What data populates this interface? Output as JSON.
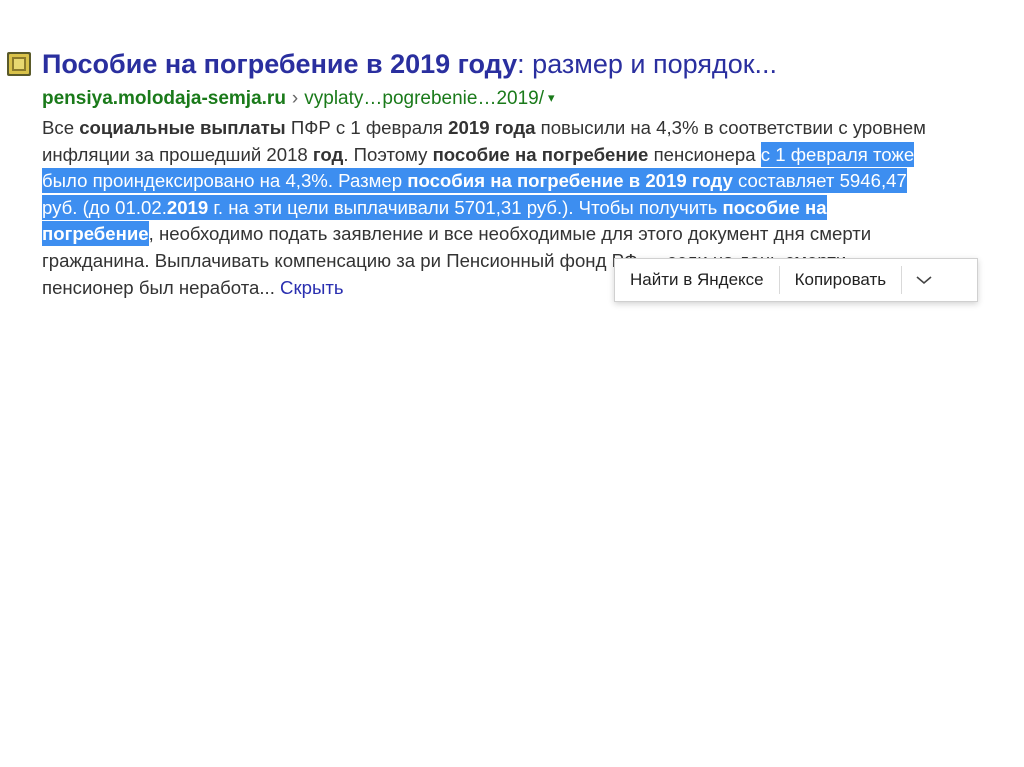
{
  "result": {
    "favicon_icon": "site-favicon-icon",
    "title_bold": "Пособие на погребение в 2019 году",
    "title_rest": ": размер и порядок...",
    "url_host": "pensiya.molodaja-semja.ru",
    "url_separator": "›",
    "url_path": "vyplaty…pogrebenie…2019/",
    "url_arrow": "▾",
    "snippet": {
      "s1": "Все ",
      "b1": "социальные выплаты",
      "s2": " ПФР с 1 февраля ",
      "b2": "2019 года",
      "s3": " повысили на 4,3% в соответствии с уровнем инфляции за прошедший 2018 ",
      "b3": "год",
      "s4": ". Поэтому ",
      "b4": "пособие на погребение",
      "s5": " пенсионера ",
      "sel1": "с 1 февраля тоже было проиндексировано на 4,3%. Размер ",
      "selb1": "пособия на погребение в 2019 году",
      "sel2": " составляет 5946,47 руб. (до 01.02.",
      "selb2": "2019",
      "sel3": " г. на эти цели выплачивали 5701,31 руб.). Чтобы получить ",
      "selb3": "пособие на погребение",
      "s6": ", необходимо подать заявление и все необходимые для этого документ",
      "s7": " дня смерти гражданина. Выплачивать компенсацию за ри",
      "s8": " Пенсионный фонд РФ — если на день смерти пенсионер был неработа... ",
      "hide_link": "Скрыть"
    }
  },
  "context_menu": {
    "find_label": "Найти в Яндексе",
    "copy_label": "Копировать",
    "more_icon": "chevron-down-icon"
  },
  "colors": {
    "title": "#2a2f9f",
    "url": "#1a7a1a",
    "selection": "#3d8ef0",
    "text": "#333333"
  }
}
